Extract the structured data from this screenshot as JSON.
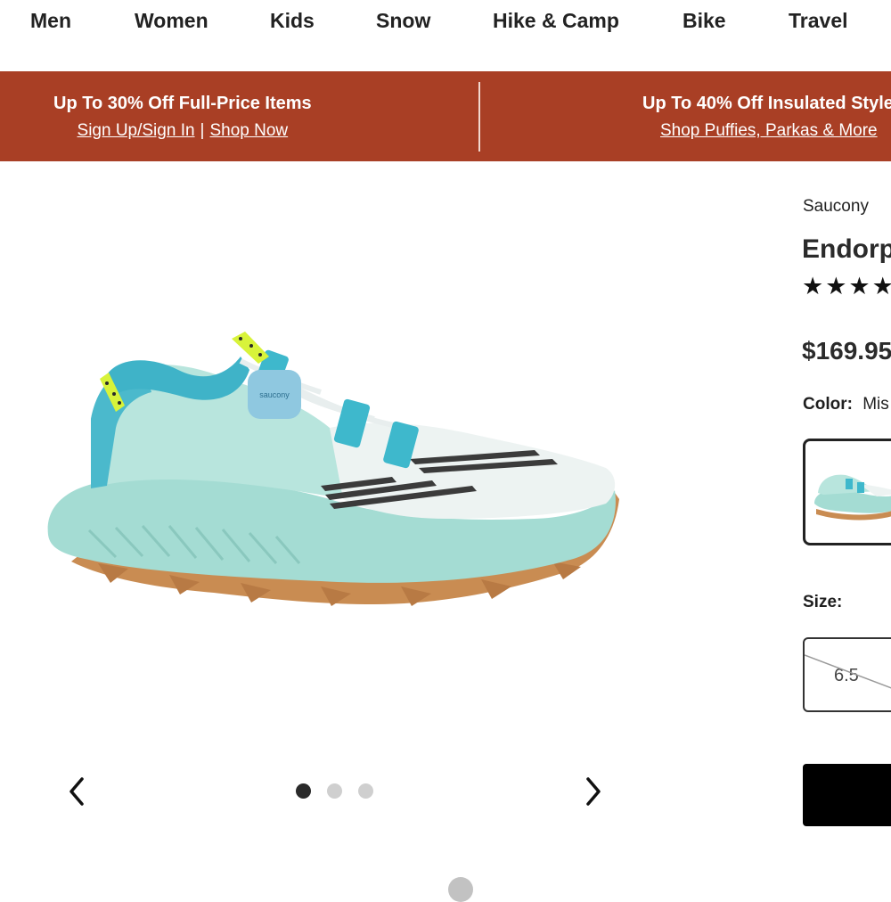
{
  "nav": {
    "items": [
      {
        "label": "Men"
      },
      {
        "label": "Women"
      },
      {
        "label": "Kids"
      },
      {
        "label": "Snow"
      },
      {
        "label": "Hike & Camp"
      },
      {
        "label": "Bike"
      },
      {
        "label": "Travel"
      }
    ]
  },
  "promo": {
    "left": {
      "title": "Up To 30% Off Full-Price Items",
      "link1": "Sign Up/Sign In",
      "separator": "|",
      "link2": "Shop Now"
    },
    "right": {
      "title": "Up To 40% Off Insulated Style",
      "link": "Shop Puffies, Parkas & More"
    },
    "background_color": "#a93f25"
  },
  "gallery": {
    "image_icon": "trail-running-shoe-image",
    "shoe_logo_text": "saucony",
    "prev_icon": "chevron-left-icon",
    "next_icon": "chevron-right-icon",
    "dots_total": 3,
    "active_dot": 1
  },
  "product": {
    "brand": "Saucony",
    "title": "Endorp",
    "stars": "★★★★",
    "price": "$169.95",
    "color_label": "Color:",
    "color_value": "Mis",
    "size_label": "Size:",
    "sizes": [
      {
        "label": "6.5",
        "available": false
      }
    ]
  },
  "colors": {
    "accent": "#a93f25",
    "cta": "#000000"
  }
}
